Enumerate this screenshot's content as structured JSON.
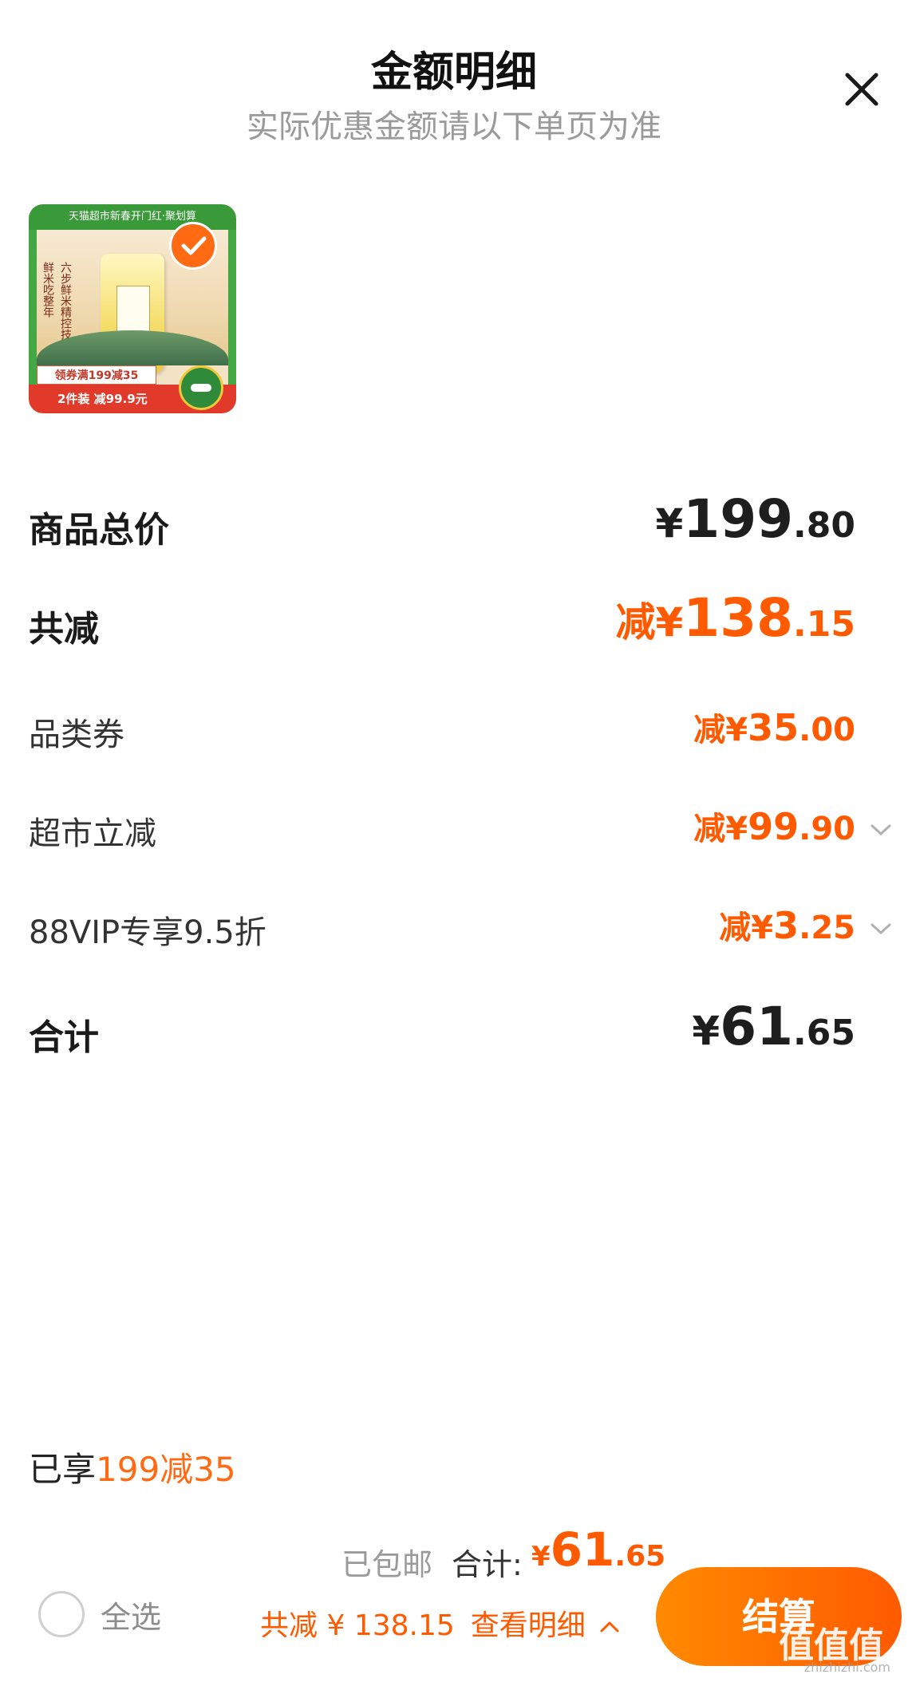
{
  "header": {
    "title": "金额明细",
    "subtitle": "实际优惠金额请以下单页为准"
  },
  "product": {
    "banner_text": "天猫超市新春开门红·聚划算",
    "vertical_text_1": "鲜米吃整年",
    "vertical_text_2": "六步鲜米精控技术",
    "coupon_text": "领券满199减35",
    "promo_text": "2件装 减99.9元",
    "selected": true
  },
  "rows": {
    "subtotal": {
      "label": "商品总价",
      "prefix": "¥",
      "int": "199",
      "dec": ".80"
    },
    "total_discount": {
      "label": "共减",
      "prefix": "减¥",
      "int": "138",
      "dec": ".15"
    },
    "category_coupon": {
      "label": "品类券",
      "prefix": "减¥",
      "int": "35",
      "dec": ".00"
    },
    "supermarket_discount": {
      "label": "超市立减",
      "prefix": "减¥",
      "int": "99",
      "dec": ".90"
    },
    "vip_discount": {
      "label": "88VIP专享9.5折",
      "prefix": "减¥",
      "int": "3",
      "dec": ".25"
    },
    "total": {
      "label": "合计",
      "prefix": "¥",
      "int": "61",
      "dec": ".65"
    }
  },
  "enjoyed": {
    "prefix": "已享",
    "highlight": "199减35"
  },
  "bottom_bar": {
    "select_all_label": "全选",
    "shipping": "已包邮",
    "total_label": "合计:",
    "total_yen": "¥",
    "total_int": "61",
    "total_dec": ".65",
    "saving_text": "共减 ¥ 138.15",
    "details_link": "查看明细",
    "checkout_label": "结算"
  },
  "watermark": {
    "text": "值值值",
    "sub": "zhizhizhi.com"
  },
  "colors": {
    "accent": "#ff5a00",
    "accent_light": "#ff8a00",
    "muted": "#9a9a9a"
  }
}
